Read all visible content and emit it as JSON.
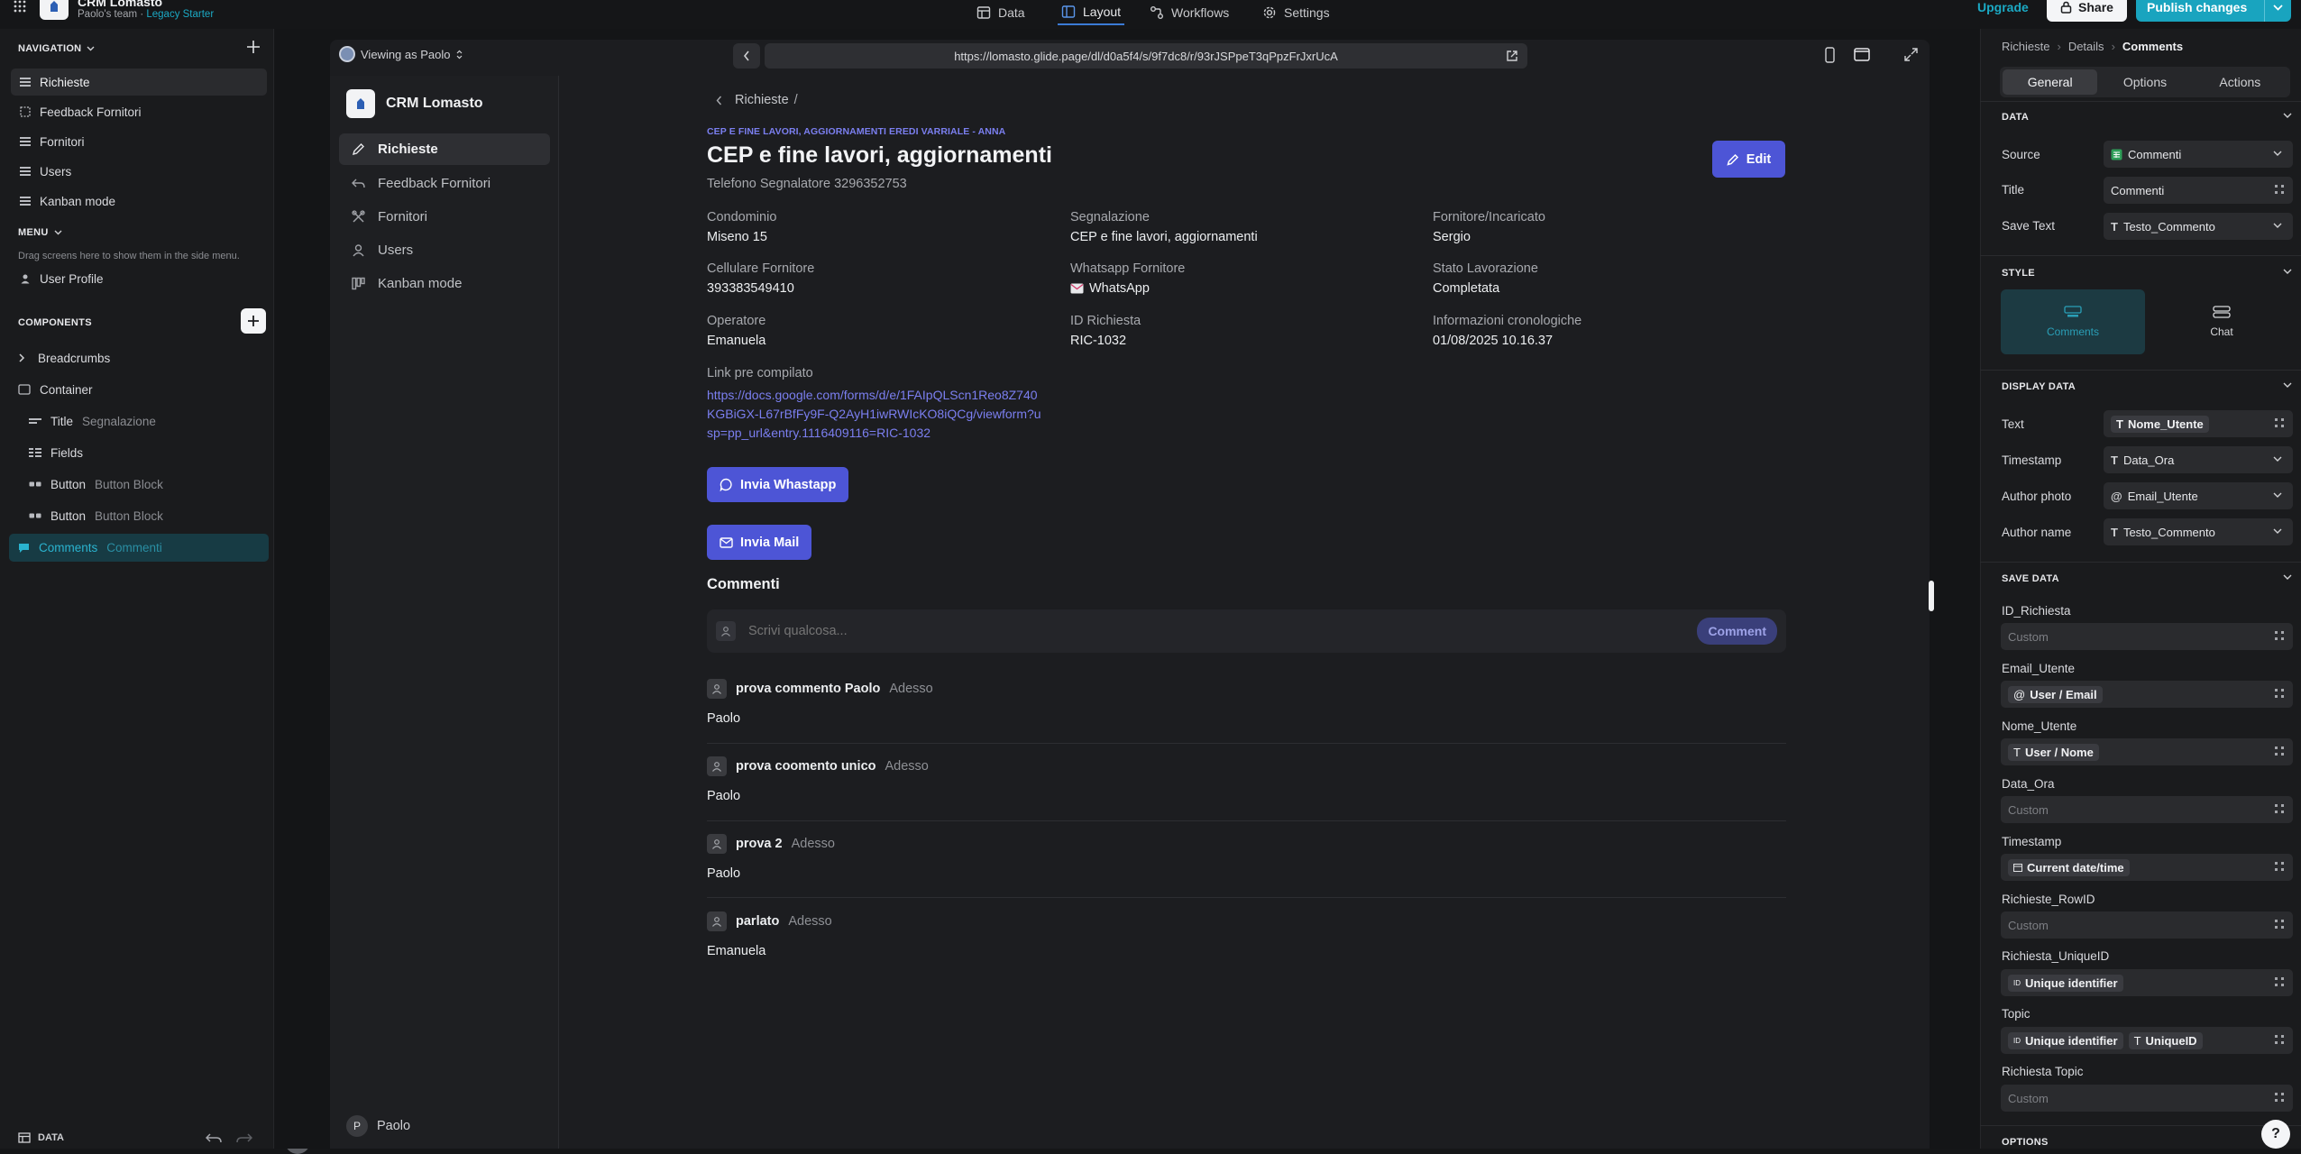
{
  "topbar": {
    "app_name": "CRM Lomasto",
    "team": "Paolo's team",
    "plan": "Legacy Starter",
    "tabs": [
      {
        "label": "Data",
        "icon": "table-icon",
        "active": false
      },
      {
        "label": "Layout",
        "icon": "layout-icon",
        "active": true
      },
      {
        "label": "Workflows",
        "icon": "workflow-icon",
        "active": false
      },
      {
        "label": "Settings",
        "icon": "gear-icon",
        "active": false
      }
    ],
    "upgrade": "Upgrade",
    "share": "Share",
    "publish": "Publish changes"
  },
  "left": {
    "navigation_title": "NAVIGATION",
    "nav_items": [
      "Richieste",
      "Feedback Fornitori",
      "Fornitori",
      "Users",
      "Kanban mode"
    ],
    "menu_title": "MENU",
    "menu_hint": "Drag screens here to show them in the side menu.",
    "menu_items": [
      "User Profile"
    ],
    "components_title": "COMPONENTS",
    "components": [
      {
        "label": "Breadcrumbs",
        "sub": ""
      },
      {
        "label": "Container",
        "sub": ""
      },
      {
        "label": "Title",
        "sub": "Segnalazione"
      },
      {
        "label": "Fields",
        "sub": ""
      },
      {
        "label": "Button",
        "sub": "Button Block"
      },
      {
        "label": "Button",
        "sub": "Button Block"
      },
      {
        "label": "Comments",
        "sub": "Commenti"
      }
    ],
    "footer_label": "DATA"
  },
  "preview": {
    "viewing_as": "Viewing as Paolo",
    "url": "https://lomasto.glide.page/dl/d0a5f4/s/9f7dc8/r/93rJSPpeT3qPpzFrJxrUcA",
    "app_title": "CRM Lomasto",
    "side_items": [
      "Richieste",
      "Feedback Fornitori",
      "Fornitori",
      "Users",
      "Kanban mode"
    ],
    "user": "Paolo",
    "user_initial": "P",
    "breadcrumb": "Richieste",
    "breadcrumb_sep": "/",
    "overline": "CEP E FINE LAVORI, AGGIORNAMENTI EREDI VARRIALE - ANNA",
    "title": "CEP e fine lavori, aggiornamenti",
    "subtitle": "Telefono Segnalatore 3296352753",
    "edit": "Edit",
    "fields": [
      {
        "label": "Condominio",
        "value": "Miseno 15"
      },
      {
        "label": "Segnalazione",
        "value": "CEP e fine lavori, aggiornamenti"
      },
      {
        "label": "Fornitore/Incaricato",
        "value": "Sergio"
      },
      {
        "label": "Cellulare Fornitore",
        "value": "393383549410"
      },
      {
        "label": "Whatsapp Fornitore",
        "value": "WhatsApp"
      },
      {
        "label": "Stato Lavorazione",
        "value": "Completata"
      },
      {
        "label": "Operatore",
        "value": "Emanuela"
      },
      {
        "label": "ID Richiesta",
        "value": "RIC-1032"
      },
      {
        "label": "Informazioni cronologiche",
        "value": "01/08/2025 10.16.37"
      }
    ],
    "link_label": "Link pre compilato",
    "link_lines": [
      "https://docs.google.com/forms/d/e/1FAIpQLScn1Reo8Z740",
      "KGBiGX-L67rBfFy9F-Q2AyH1iwRWIcKO8iQCg/viewform?u",
      "sp=pp_url&entry.1116409116=RIC-1032"
    ],
    "btn_whatsapp": "Invia Whastapp",
    "btn_mail": "Invia Mail",
    "comments_title": "Commenti",
    "comment_placeholder": "Scrivi qualcosa...",
    "comment_button": "Comment",
    "comments": [
      {
        "title": "prova commento Paolo",
        "time": "Adesso",
        "author": "Paolo"
      },
      {
        "title": "prova coomento unico",
        "time": "Adesso",
        "author": "Paolo"
      },
      {
        "title": "prova 2",
        "time": "Adesso",
        "author": "Paolo"
      },
      {
        "title": "parlato",
        "time": "Adesso",
        "author": "Emanuela"
      }
    ]
  },
  "right": {
    "breadcrumb": [
      "Richieste",
      "Details",
      "Comments"
    ],
    "tabs": [
      "General",
      "Options",
      "Actions"
    ],
    "data_title": "DATA",
    "source_label": "Source",
    "source_value": "Commenti",
    "title_label": "Title",
    "title_value": "Commenti",
    "savetext_label": "Save Text",
    "savetext_value": "Testo_Commento",
    "style_title": "STYLE",
    "style_options": [
      "Comments",
      "Chat"
    ],
    "display_title": "DISPLAY DATA",
    "display_rows": [
      {
        "label": "Text",
        "value": "Nome_Utente"
      },
      {
        "label": "Timestamp",
        "value": "Data_Ora"
      },
      {
        "label": "Author photo",
        "value": "Email_Utente"
      },
      {
        "label": "Author name",
        "value": "Testo_Commento"
      }
    ],
    "save_title": "SAVE DATA",
    "save_rows": [
      {
        "label": "ID_Richiesta",
        "value": "Custom"
      },
      {
        "label": "Email_Utente",
        "value": "User / Email"
      },
      {
        "label": "Nome_Utente",
        "value": "User / Nome"
      },
      {
        "label": "Data_Ora",
        "value": "Custom"
      },
      {
        "label": "Timestamp",
        "value": "Current date/time"
      },
      {
        "label": "Richieste_RowID",
        "value": "Custom"
      },
      {
        "label": "Richiesta_UniqueID",
        "value": "Unique identifier"
      },
      {
        "label": "Topic",
        "value": "Unique identifier",
        "value2": "UniqueID"
      },
      {
        "label": "Richiesta Topic",
        "value": "Custom"
      }
    ],
    "options_title": "OPTIONS"
  },
  "colors": {
    "accent": "#4d55d6",
    "link": "#7b7ff0",
    "teal": "#1ba9c4",
    "selected_cyan": "#2a9fb7"
  }
}
